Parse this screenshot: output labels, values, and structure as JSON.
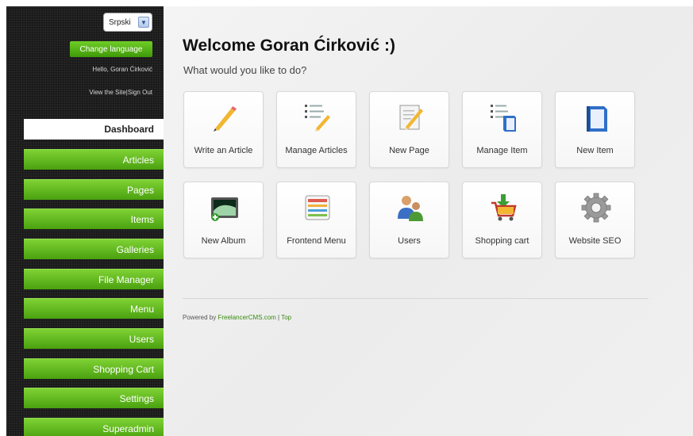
{
  "sidebar": {
    "language_selected": "Srpski",
    "change_language_label": "Change language",
    "greeting": "Hello, Goran Ćirković",
    "view_site_label": "View the Site",
    "separator": "|",
    "sign_out_label": "Sign Out",
    "nav": {
      "dashboard": "Dashboard",
      "items": [
        {
          "label": "Articles"
        },
        {
          "label": "Pages"
        },
        {
          "label": "Items"
        },
        {
          "label": "Galleries"
        },
        {
          "label": "File Manager"
        },
        {
          "label": "Menu"
        },
        {
          "label": "Users"
        },
        {
          "label": "Shopping Cart"
        },
        {
          "label": "Settings"
        },
        {
          "label": "Superadmin"
        }
      ]
    }
  },
  "main": {
    "title": "Welcome Goran Ćirković :)",
    "subtitle": "What would you like to do?",
    "tiles": [
      {
        "label": "Write an Article",
        "icon": "pencil-icon"
      },
      {
        "label": "Manage Articles",
        "icon": "list-pencil-icon"
      },
      {
        "label": "New Page",
        "icon": "new-page-icon"
      },
      {
        "label": "Manage Item",
        "icon": "manage-item-icon"
      },
      {
        "label": "New Item",
        "icon": "new-item-icon"
      },
      {
        "label": "New Album",
        "icon": "album-icon"
      },
      {
        "label": "Frontend Menu",
        "icon": "menu-icon"
      },
      {
        "label": "Users",
        "icon": "users-icon"
      },
      {
        "label": "Shopping cart",
        "icon": "shopping-cart-icon"
      },
      {
        "label": "Website SEO",
        "icon": "gear-icon"
      }
    ],
    "footer": {
      "prefix": "Powered by ",
      "link": "FreelancerCMS.com",
      "separator": " | ",
      "top": "Top"
    }
  },
  "colors": {
    "sidebar_bg": "#1f1f1f",
    "nav_green": "#5cb81c",
    "accent_green": "#3a8c11"
  }
}
